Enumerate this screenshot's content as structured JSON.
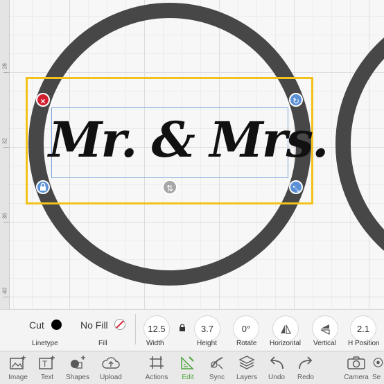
{
  "ruler": {
    "ticks": [
      "28",
      "32",
      "36",
      "40"
    ]
  },
  "canvas": {
    "text_object": "Mr. & Mrs."
  },
  "handles": {
    "close": "×",
    "rotate": "↻",
    "lock": "🔒",
    "scale": "⤡",
    "flip": "⇅"
  },
  "properties": {
    "linetype": {
      "value": "Cut",
      "label": "Linetype"
    },
    "fill": {
      "value": "No Fill",
      "label": "Fill"
    },
    "width": {
      "value": "12.5",
      "label": "Width"
    },
    "height": {
      "value": "3.7",
      "label": "Height"
    },
    "rotate": {
      "value": "0°",
      "label": "Rotate"
    },
    "horizontal": {
      "label": "Horizontal"
    },
    "vertical": {
      "label": "Vertical"
    },
    "h_position": {
      "value": "2.1",
      "label": "H Position"
    }
  },
  "toolbar": {
    "items": [
      {
        "label": "Image",
        "icon": "image-icon"
      },
      {
        "label": "Text",
        "icon": "text-icon"
      },
      {
        "label": "Shapes",
        "icon": "shapes-icon"
      },
      {
        "label": "Upload",
        "icon": "upload-icon"
      },
      {
        "label": "Actions",
        "icon": "actions-icon"
      },
      {
        "label": "Edit",
        "icon": "edit-icon",
        "active": true
      },
      {
        "label": "Sync",
        "icon": "sync-icon"
      },
      {
        "label": "Layers",
        "icon": "layers-icon"
      },
      {
        "label": "Undo",
        "icon": "undo-icon"
      },
      {
        "label": "Redo",
        "icon": "redo-icon"
      },
      {
        "label": "Camera",
        "icon": "camera-icon"
      },
      {
        "label": "Se",
        "icon": "settings-icon"
      }
    ]
  },
  "colors": {
    "accent": "#4ca33a",
    "selection": "#f2c21b",
    "handle_blue": "#5b8fd6",
    "close_red": "#d21f2e",
    "ring": "#474747"
  }
}
